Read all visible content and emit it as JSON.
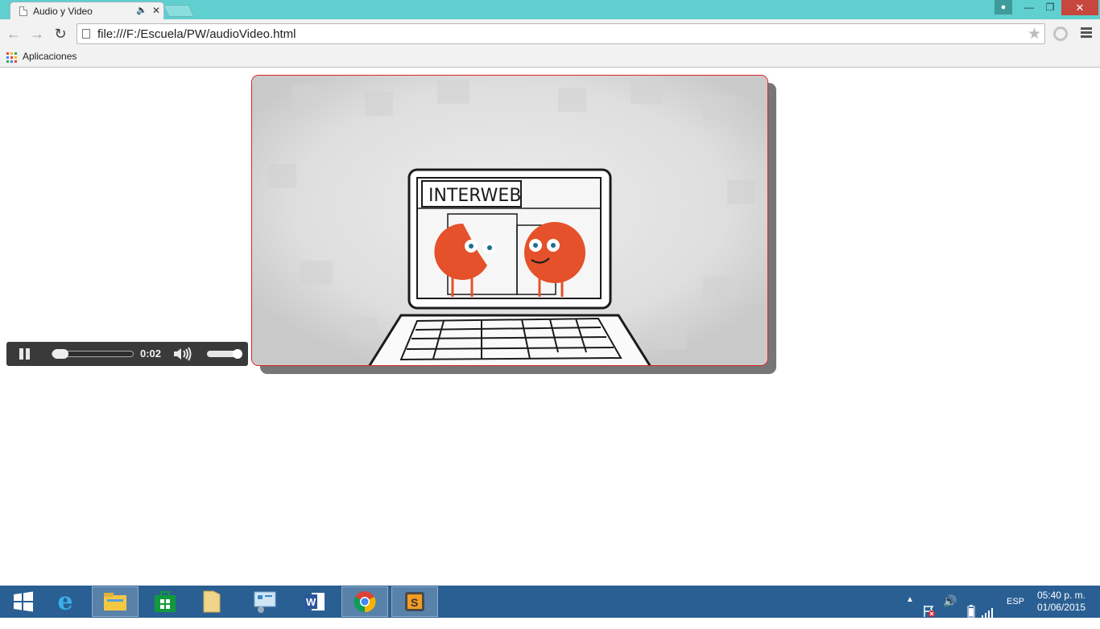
{
  "browser": {
    "tab": {
      "title": "Audio y Video",
      "audio_icon": "speaker-icon",
      "close_icon": "close-icon"
    },
    "window_controls": [
      "user-icon",
      "minimize-icon",
      "restore-icon",
      "close-icon"
    ],
    "url": "file:///F:/Escuela/PW/audioVideo.html",
    "bookmarks_bar": {
      "apps_label": "Aplicaciones"
    }
  },
  "page": {
    "audio_player": {
      "state": "playing",
      "current_time": "0:02",
      "progress_fraction": 0.02,
      "volume_fraction": 1.0
    },
    "video": {
      "frame_text": "INTERWEB",
      "colors": {
        "border": "#e02222",
        "character": "#e5512a"
      }
    }
  },
  "taskbar": {
    "apps": [
      "start-icon",
      "internet-explorer-icon",
      "file-explorer-icon",
      "store-icon",
      "folder-icon",
      "control-panel-icon",
      "word-icon",
      "chrome-icon",
      "sublime-text-icon"
    ],
    "tray": {
      "language": "ESP",
      "time": "05:40 p. m.",
      "date": "01/06/2015"
    }
  }
}
